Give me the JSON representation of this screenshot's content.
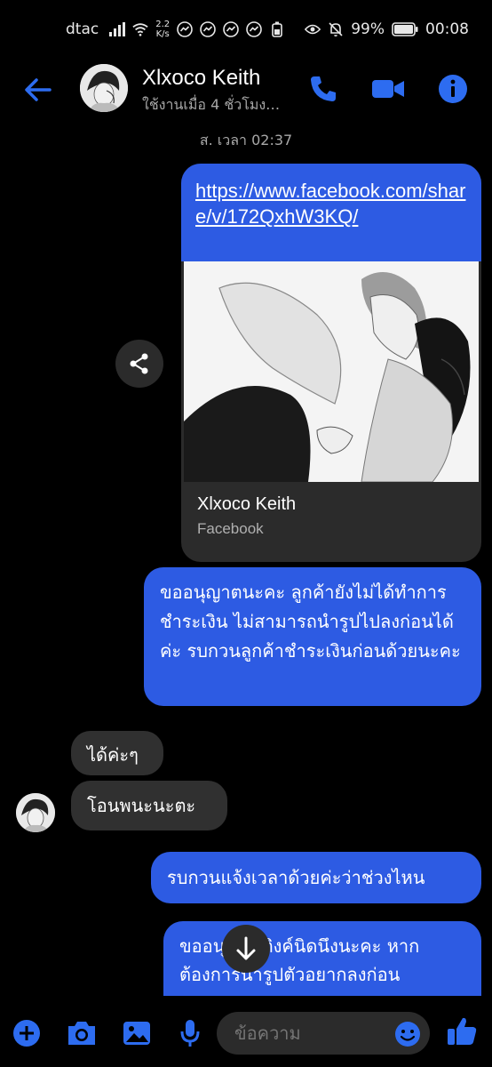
{
  "status": {
    "carrier": "dtac",
    "speed_value": "2.2",
    "speed_unit": "K/s",
    "battery": "99%",
    "time": "00:08"
  },
  "header": {
    "name": "Xlxoco Keith",
    "subtitle": "ใช้งานเมื่อ 4 ชั่วโมง…"
  },
  "chat": {
    "timestamp": "ส. เวลา 02:37",
    "link": {
      "url": "https://www.facebook.com/share/v/172QxhW3KQ/",
      "title": "Xlxoco Keith",
      "site": "Facebook"
    },
    "messages": {
      "out1": "ขออนุญาตนะคะ ลูกค้ายังไม่ได้ทำการชำระเงิน ไม่สามารถนำรูปไปลงก่อนได้ค่ะ รบกวนลูกค้าชำระเงินก่อนด้วยนะคะ",
      "in1": "ได้ค่ะๆ",
      "in2": "โอนพนะนะตะ",
      "out2": "รบกวนแจ้งเวลาด้วยค่ะว่าช่วงไหน",
      "out3": "ขออนุญาตติงค์นิดนึงนะคะ หากต้องการนำรูปตัวอยากลงก่อน"
    }
  },
  "composer": {
    "placeholder": "ข้อความ"
  },
  "colors": {
    "accent": "#2d5be3",
    "incoming_bubble": "#303030",
    "background": "#000000"
  }
}
